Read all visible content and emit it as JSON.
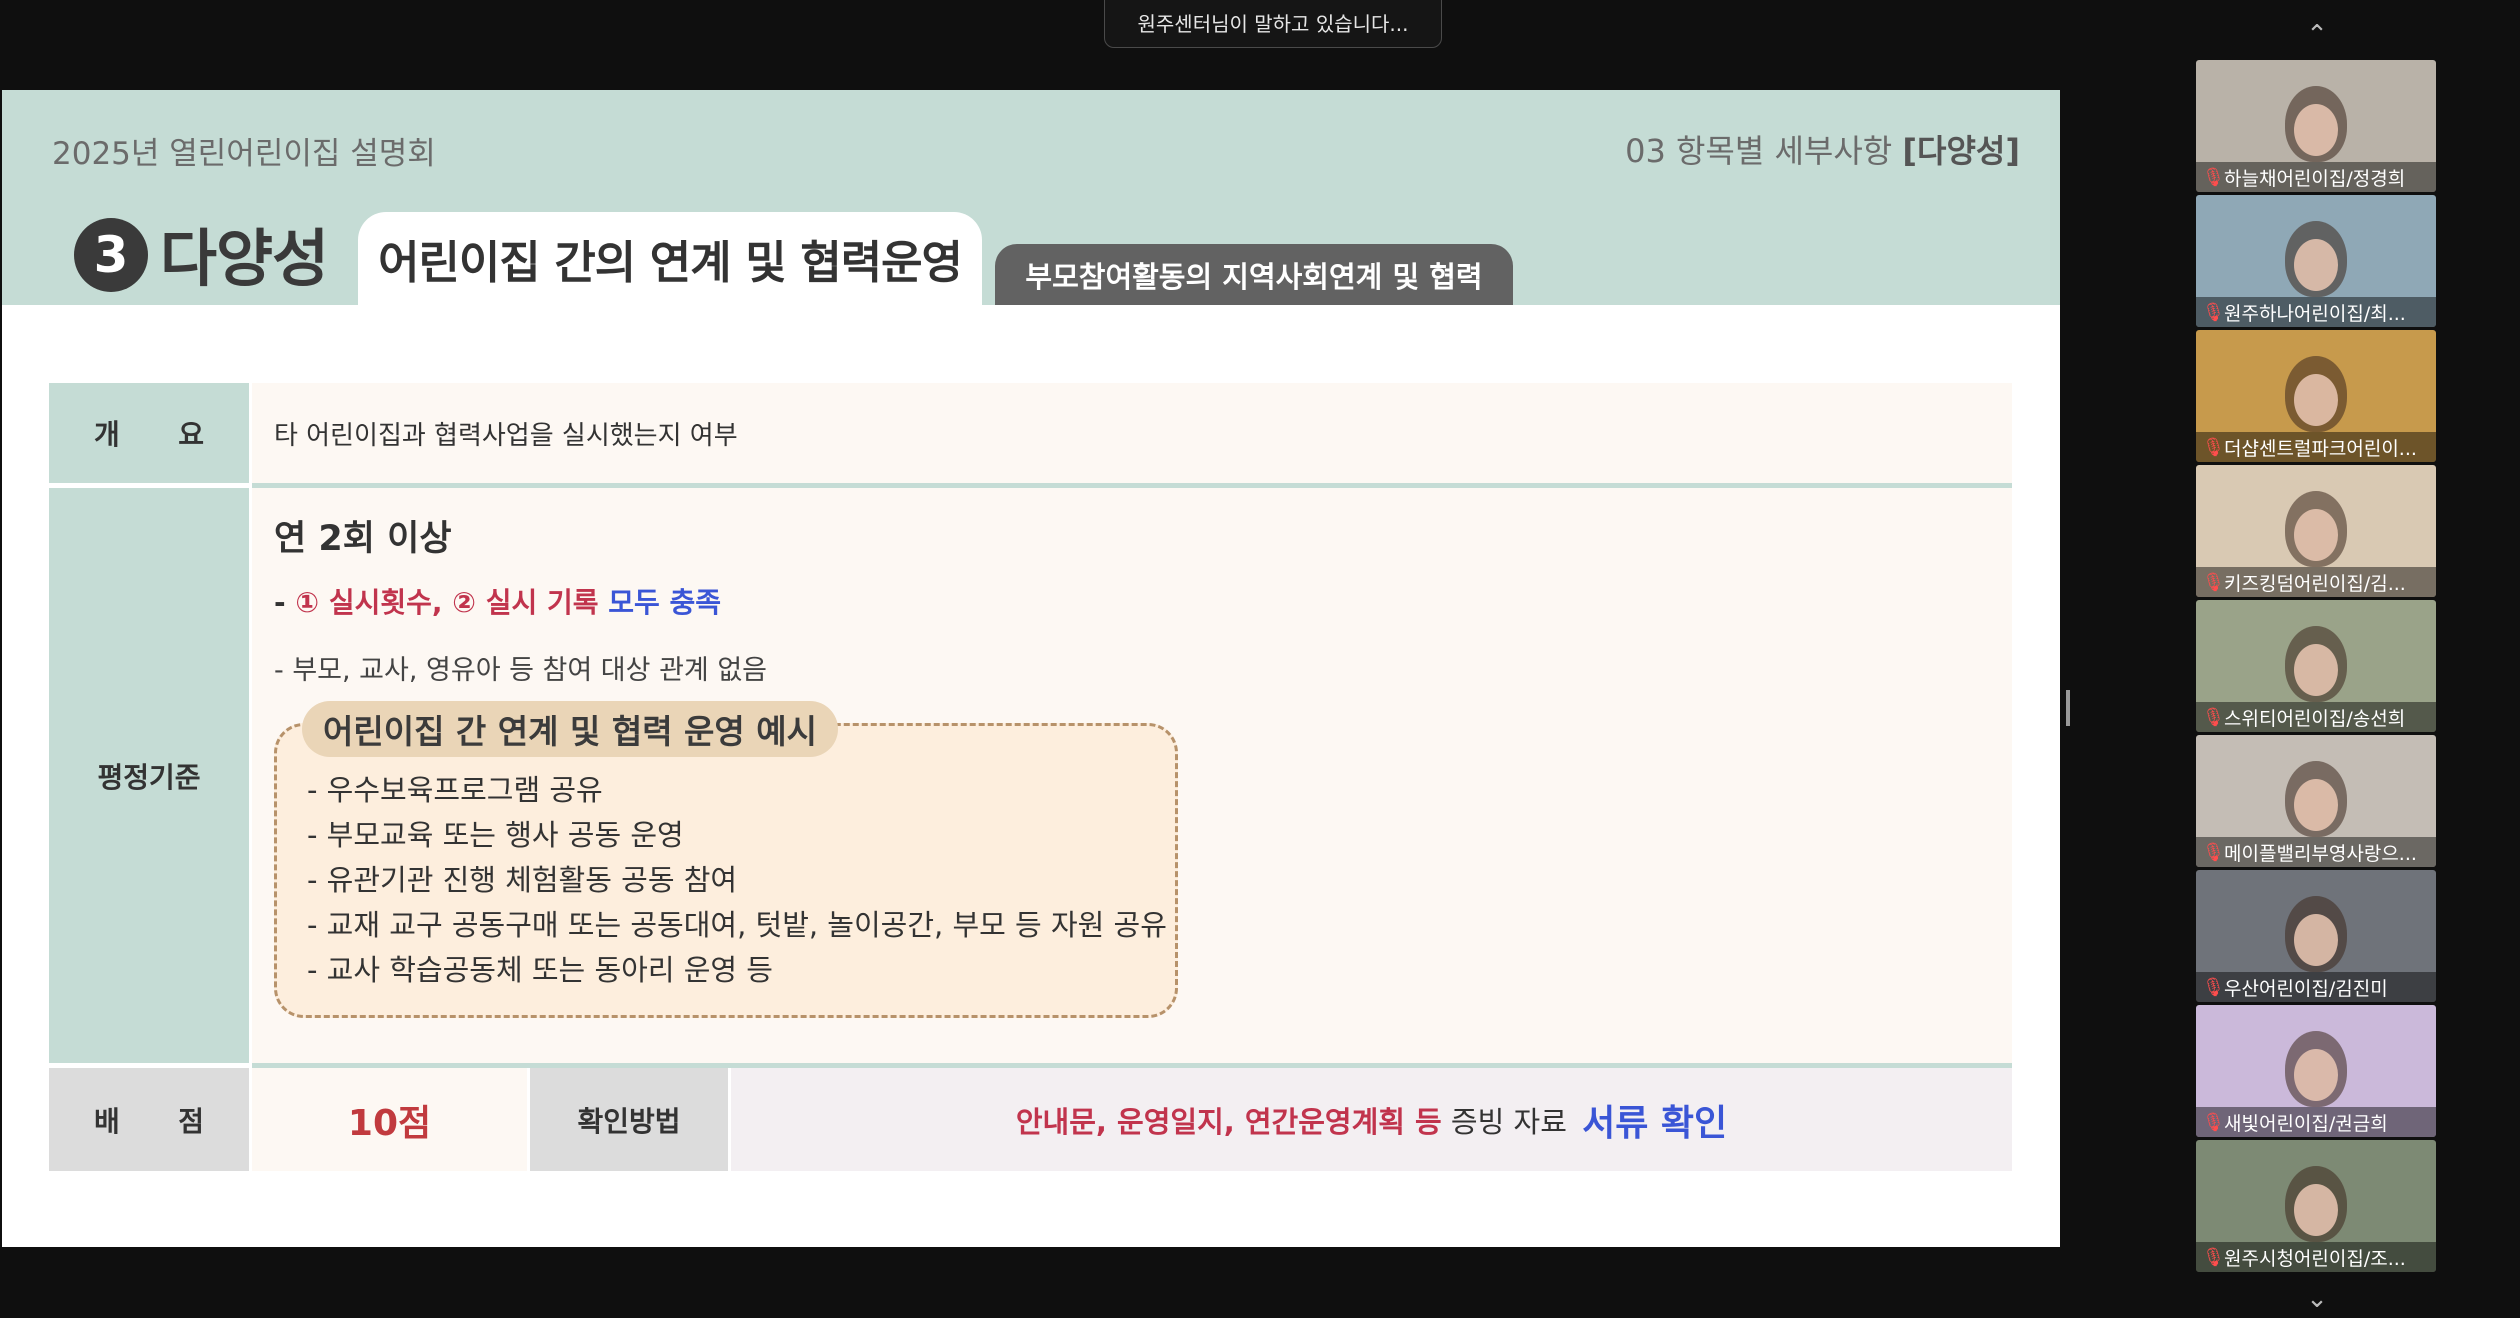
{
  "banner": {
    "speaking_text": "원주센터님이 말하고 있습니다..."
  },
  "slide": {
    "deck_title": "2025년 열린어린이집 설명회",
    "section_label_prefix": "03 항목별 세부사항 ",
    "section_label_bold": "[다양성]",
    "category_number": "3",
    "category_title": "다양성",
    "tab_active": "어린이집 간의 연계 및 협력운영",
    "tab_inactive": "부모참여활동의 지역사회연계 및 협력",
    "overview": {
      "label": "개      요",
      "text": "타 어린이집과 협력사업을 실시했는지 여부"
    },
    "criteria": {
      "label": "평정기준",
      "main": "연 2회 이상",
      "line1_dash": "- ",
      "line1_red": "① 실시횟수, ② 실시 기록 ",
      "line1_blue": "모두 충족",
      "line2": "- 부모, 교사, 영유아 등 참여 대상 관계 없음",
      "example_title": "어린이집 간 연계 및 협력 운영 예시",
      "examples": [
        "- 우수보육프로그램 공유",
        "- 부모교육 또는 행사 공동 운영",
        "- 유관기관 진행 체험활동 공동 참여",
        "- 교재 교구 공동구매 또는 공동대여, 텃밭, 놀이공간, 부모 등 자원 공유",
        "- 교사 학습공동체 또는 동아리 운영 등"
      ]
    },
    "score": {
      "label": "배      점",
      "value": "10점",
      "method_label": "확인방법",
      "method_red": "안내문, 운영일지, 연간운영계획 등",
      "method_mid": " 증빙 자료 ",
      "method_blue": "서류 확인"
    }
  },
  "participants": [
    {
      "name": "하늘채어린이집/정경희",
      "bg": "#b9b2a8"
    },
    {
      "name": "원주하나어린이집/최...",
      "bg": "#8fa8b6"
    },
    {
      "name": "더샵센트럴파크어린이...",
      "bg": "#c79a4c"
    },
    {
      "name": "키즈킹덤어린이집/김...",
      "bg": "#d9c9b3"
    },
    {
      "name": "스위티어린이집/송선희",
      "bg": "#9aa389"
    },
    {
      "name": "메이플밸리부영사랑으...",
      "bg": "#c4bdb5"
    },
    {
      "name": "우산어린이집/김진미",
      "bg": "#6f737a"
    },
    {
      "name": "새빛어린이집/권금희",
      "bg": "#cbb9da"
    },
    {
      "name": "원주시청어린이집/조...",
      "bg": "#7d8a74"
    }
  ],
  "icons": {
    "mic_muted": "mic-muted-icon",
    "scroll_up": "chevron-up-icon",
    "scroll_down": "chevron-down-icon"
  }
}
